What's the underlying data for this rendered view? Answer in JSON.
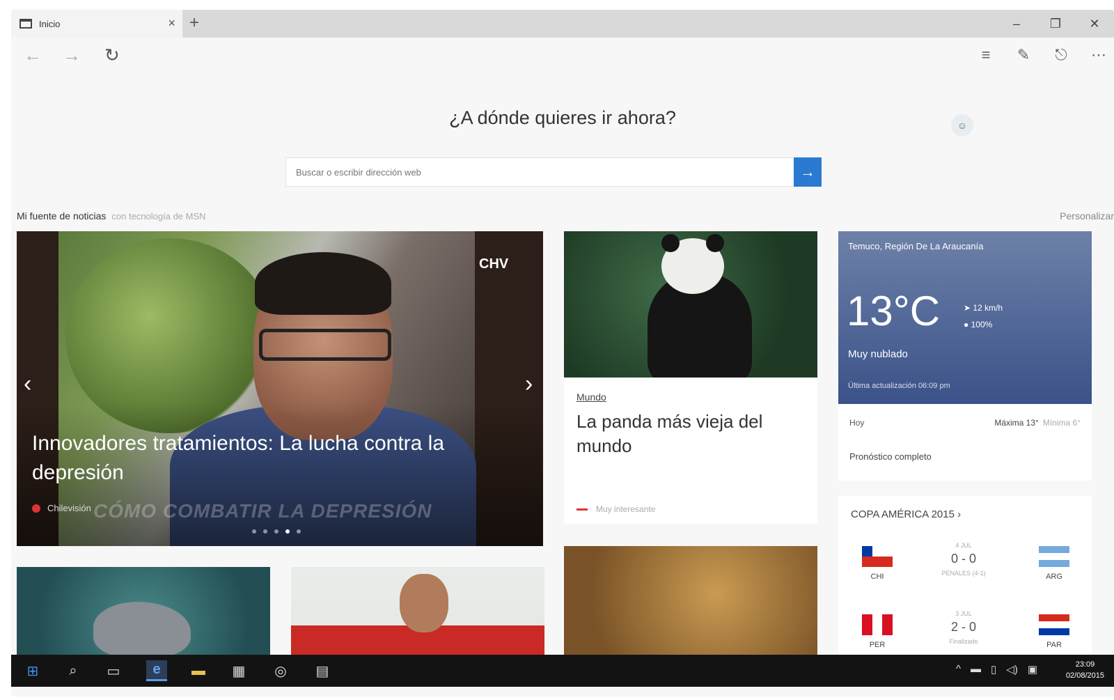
{
  "browser": {
    "tab_title": "Inicio",
    "tab_close": "×",
    "new_tab": "+",
    "window_controls": {
      "minimize": "–",
      "restore": "❐",
      "close": "✕"
    },
    "nav": {
      "back": "←",
      "forward": "→",
      "refresh": "↻"
    },
    "tools": {
      "hub": "≡",
      "note": "✎",
      "share": "⎋",
      "more": "⋯"
    }
  },
  "start_page": {
    "heading": "¿A dónde quieres ir ahora?",
    "profile_label": "☺",
    "search": {
      "placeholder": "Buscar o escribir dirección web",
      "go": "→"
    },
    "feed_title": "Mi fuente de noticias",
    "feed_subtitle": "con tecnología de MSN",
    "personalize": "Personalizar"
  },
  "hero": {
    "logo": "CHV",
    "headline": "Innovadores tratamientos: La lucha contra la depresión",
    "source": "Chilevisión",
    "watermark": "CÓMO COMBATIR LA DEPRESIÓN",
    "prev": "‹",
    "next": "›",
    "carousel_count": 5,
    "carousel_active": 4
  },
  "panda_card": {
    "category": "Mundo",
    "title": "La panda más vieja del mundo",
    "meta": "Muy interesante"
  },
  "weather": {
    "location": "Temuco, Región De La Araucanía",
    "temperature": "13°C",
    "wind": "12 km/h",
    "humidity": "100%",
    "condition": "Muy nublado",
    "updated": "Última actualización 06:09 pm",
    "today": "Hoy",
    "max": "Máxima 13°",
    "min": "Mínima 6°",
    "full_forecast": "Pronóstico completo"
  },
  "copa": {
    "title": "COPA AMÉRICA 2015 ›",
    "matches": [
      {
        "home": "CHI",
        "away": "ARG",
        "score": "0 - 0",
        "note": "4 JUL",
        "sub": "PENALES (4-1)"
      },
      {
        "home": "PER",
        "away": "PAR",
        "score": "2 - 0",
        "note": "3 JUL",
        "sub": "Finalizado"
      }
    ],
    "colors": {
      "chile_red": "#d52b1e",
      "chile_blue": "#0039a6",
      "argentina_blue": "#75aadb",
      "peru_red": "#d91023",
      "paraguay_red": "#d52b1e",
      "paraguay_blue": "#0038a8"
    }
  },
  "taskbar": {
    "start": "⊞",
    "search": "⌕",
    "task_view": "▭",
    "edge": "e",
    "explorer": "▬",
    "store": "▦",
    "media": "◎",
    "video": "▤",
    "tray": [
      "^",
      "▬",
      "▯",
      "◁)",
      "▣"
    ],
    "time": "23:09",
    "date": "02/08/2015"
  },
  "colors": {
    "accent": "#2a7ad1",
    "taskbar": "#131313",
    "weather_bg": "#3b5289"
  }
}
